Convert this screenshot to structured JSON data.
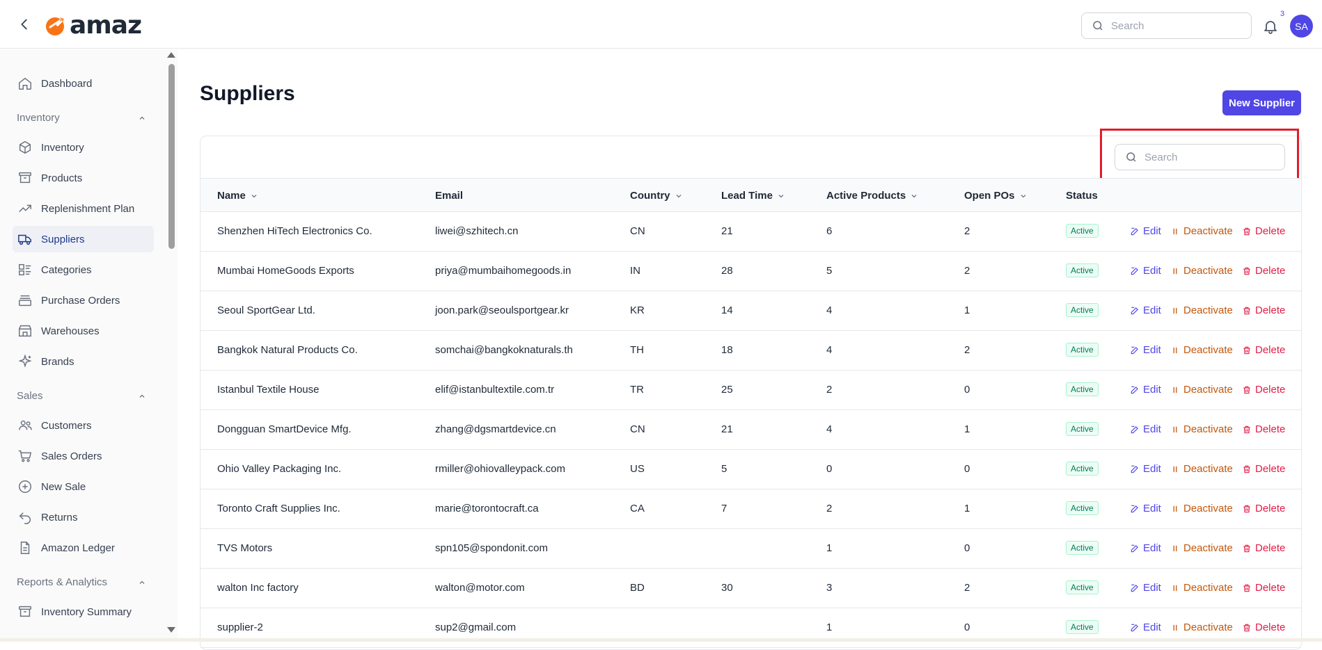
{
  "header": {
    "logo_text": "amaz",
    "search_placeholder": "Search",
    "notification_count": "3",
    "avatar_initials": "SA"
  },
  "sidebar": {
    "items": [
      {
        "label": "Dashboard",
        "icon": "home-icon"
      },
      {
        "section": "Inventory"
      },
      {
        "label": "Inventory",
        "icon": "cube-icon"
      },
      {
        "label": "Products",
        "icon": "archive-icon"
      },
      {
        "label": "Replenishment Plan",
        "icon": "trending-icon"
      },
      {
        "label": "Suppliers",
        "icon": "truck-icon",
        "active": true
      },
      {
        "label": "Categories",
        "icon": "categories-icon"
      },
      {
        "label": "Purchase Orders",
        "icon": "tray-icon"
      },
      {
        "label": "Warehouses",
        "icon": "warehouse-icon"
      },
      {
        "label": "Brands",
        "icon": "sparkles-icon"
      },
      {
        "section": "Sales"
      },
      {
        "label": "Customers",
        "icon": "users-icon"
      },
      {
        "label": "Sales Orders",
        "icon": "cart-icon"
      },
      {
        "label": "New Sale",
        "icon": "plus-circle-icon"
      },
      {
        "label": "Returns",
        "icon": "return-icon"
      },
      {
        "label": "Amazon Ledger",
        "icon": "document-icon"
      },
      {
        "section": "Reports & Analytics"
      },
      {
        "label": "Inventory Summary",
        "icon": "archive-icon"
      }
    ]
  },
  "page": {
    "title": "Suppliers",
    "new_button": "New Supplier",
    "table_search_placeholder": "Search"
  },
  "table": {
    "columns": [
      "Name",
      "Email",
      "Country",
      "Lead Time",
      "Active Products",
      "Open POs",
      "Status"
    ],
    "actions": {
      "edit": "Edit",
      "deactivate": "Deactivate",
      "delete": "Delete"
    },
    "rows": [
      {
        "name": "Shenzhen HiTech Electronics Co.",
        "email": "liwei@szhitech.cn",
        "country": "CN",
        "lead_time": "21",
        "active_products": "6",
        "open_pos": "2",
        "status": "Active"
      },
      {
        "name": "Mumbai HomeGoods Exports",
        "email": "priya@mumbaihomegoods.in",
        "country": "IN",
        "lead_time": "28",
        "active_products": "5",
        "open_pos": "2",
        "status": "Active"
      },
      {
        "name": "Seoul SportGear Ltd.",
        "email": "joon.park@seoulsportgear.kr",
        "country": "KR",
        "lead_time": "14",
        "active_products": "4",
        "open_pos": "1",
        "status": "Active"
      },
      {
        "name": "Bangkok Natural Products Co.",
        "email": "somchai@bangkoknaturals.th",
        "country": "TH",
        "lead_time": "18",
        "active_products": "4",
        "open_pos": "2",
        "status": "Active"
      },
      {
        "name": "Istanbul Textile House",
        "email": "elif@istanbultextile.com.tr",
        "country": "TR",
        "lead_time": "25",
        "active_products": "2",
        "open_pos": "0",
        "status": "Active"
      },
      {
        "name": "Dongguan SmartDevice Mfg.",
        "email": "zhang@dgsmartdevice.cn",
        "country": "CN",
        "lead_time": "21",
        "active_products": "4",
        "open_pos": "1",
        "status": "Active"
      },
      {
        "name": "Ohio Valley Packaging Inc.",
        "email": "rmiller@ohiovalleypack.com",
        "country": "US",
        "lead_time": "5",
        "active_products": "0",
        "open_pos": "0",
        "status": "Active"
      },
      {
        "name": "Toronto Craft Supplies Inc.",
        "email": "marie@torontocraft.ca",
        "country": "CA",
        "lead_time": "7",
        "active_products": "2",
        "open_pos": "1",
        "status": "Active"
      },
      {
        "name": "TVS Motors",
        "email": "spn105@spondonit.com",
        "country": "",
        "lead_time": "",
        "active_products": "1",
        "open_pos": "0",
        "status": "Active"
      },
      {
        "name": "walton Inc factory",
        "email": "walton@motor.com",
        "country": "BD",
        "lead_time": "30",
        "active_products": "3",
        "open_pos": "2",
        "status": "Active"
      },
      {
        "name": "supplier-2",
        "email": "sup2@gmail.com",
        "country": "",
        "lead_time": "",
        "active_products": "1",
        "open_pos": "0",
        "status": "Active"
      }
    ]
  },
  "colors": {
    "accent": "#4f46e5",
    "deactivate": "#c2570c",
    "delete": "#e11d48",
    "status_active": "#047857",
    "highlight_box": "#e11d2b"
  }
}
